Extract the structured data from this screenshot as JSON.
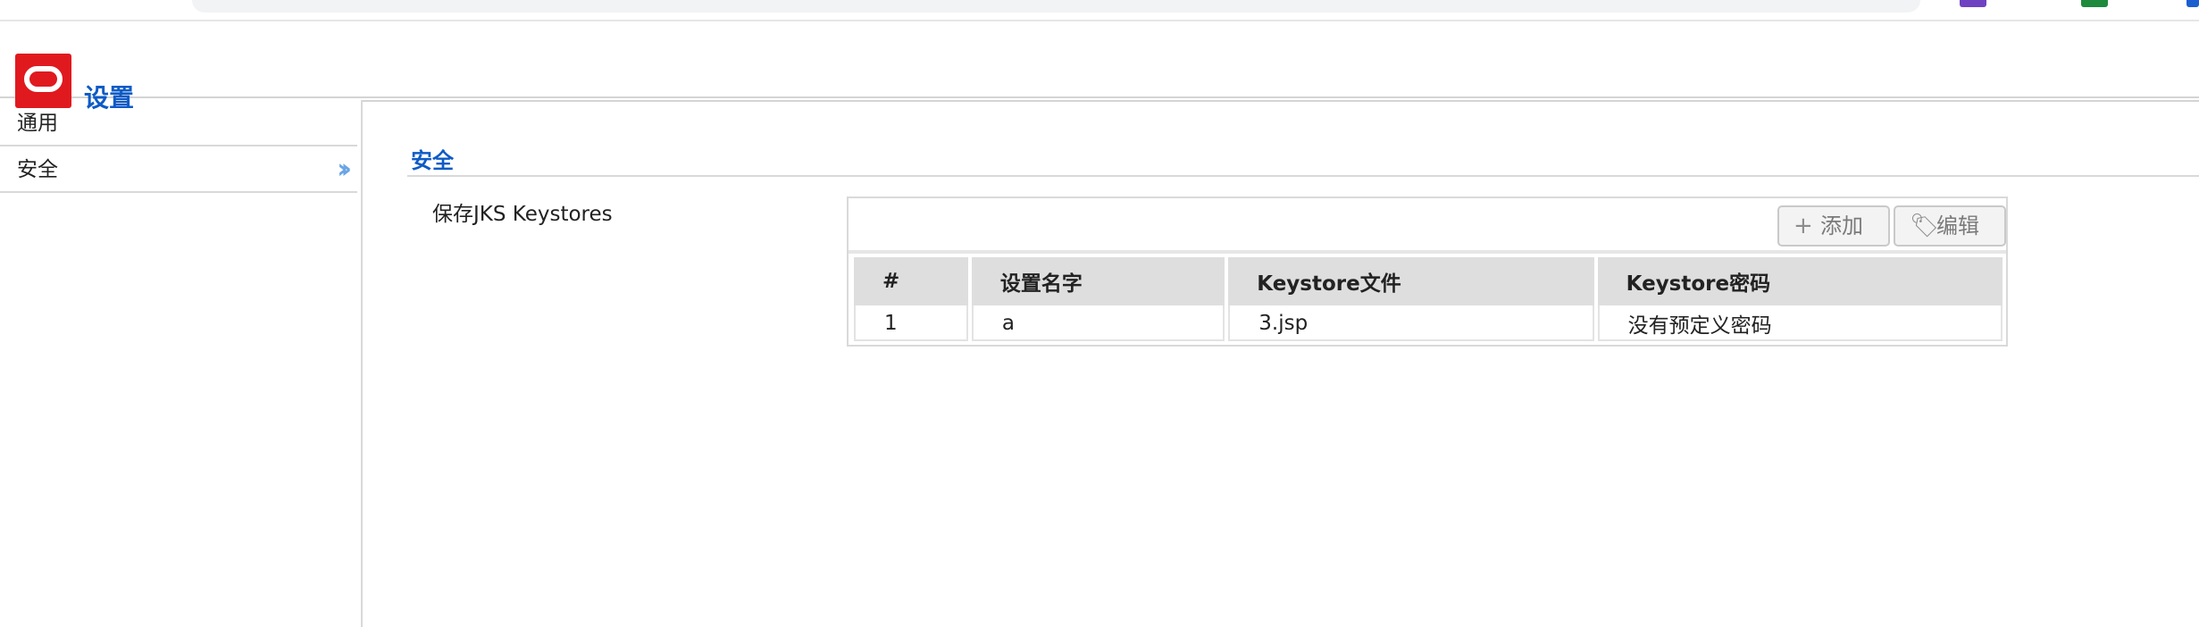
{
  "colors": {
    "accent": "#0d5bc6",
    "logo": "#e0191f"
  },
  "header": {
    "title": "设置",
    "logo_icon": "oracle-logo-icon"
  },
  "sidebar": {
    "items": [
      {
        "label": "通用"
      },
      {
        "label": "安全",
        "indicator": "double-chevron-right-icon"
      }
    ]
  },
  "main": {
    "section_title": "安全",
    "field_label": "保存JKS Keystores",
    "toolbar": {
      "add_label": "添加",
      "edit_label": "编辑"
    },
    "table": {
      "headers": [
        "#",
        "设置名字",
        "Keystore文件",
        "Keystore密码"
      ],
      "rows": [
        [
          "1",
          "a",
          "3.jsp",
          "没有预定义密码"
        ]
      ]
    }
  }
}
